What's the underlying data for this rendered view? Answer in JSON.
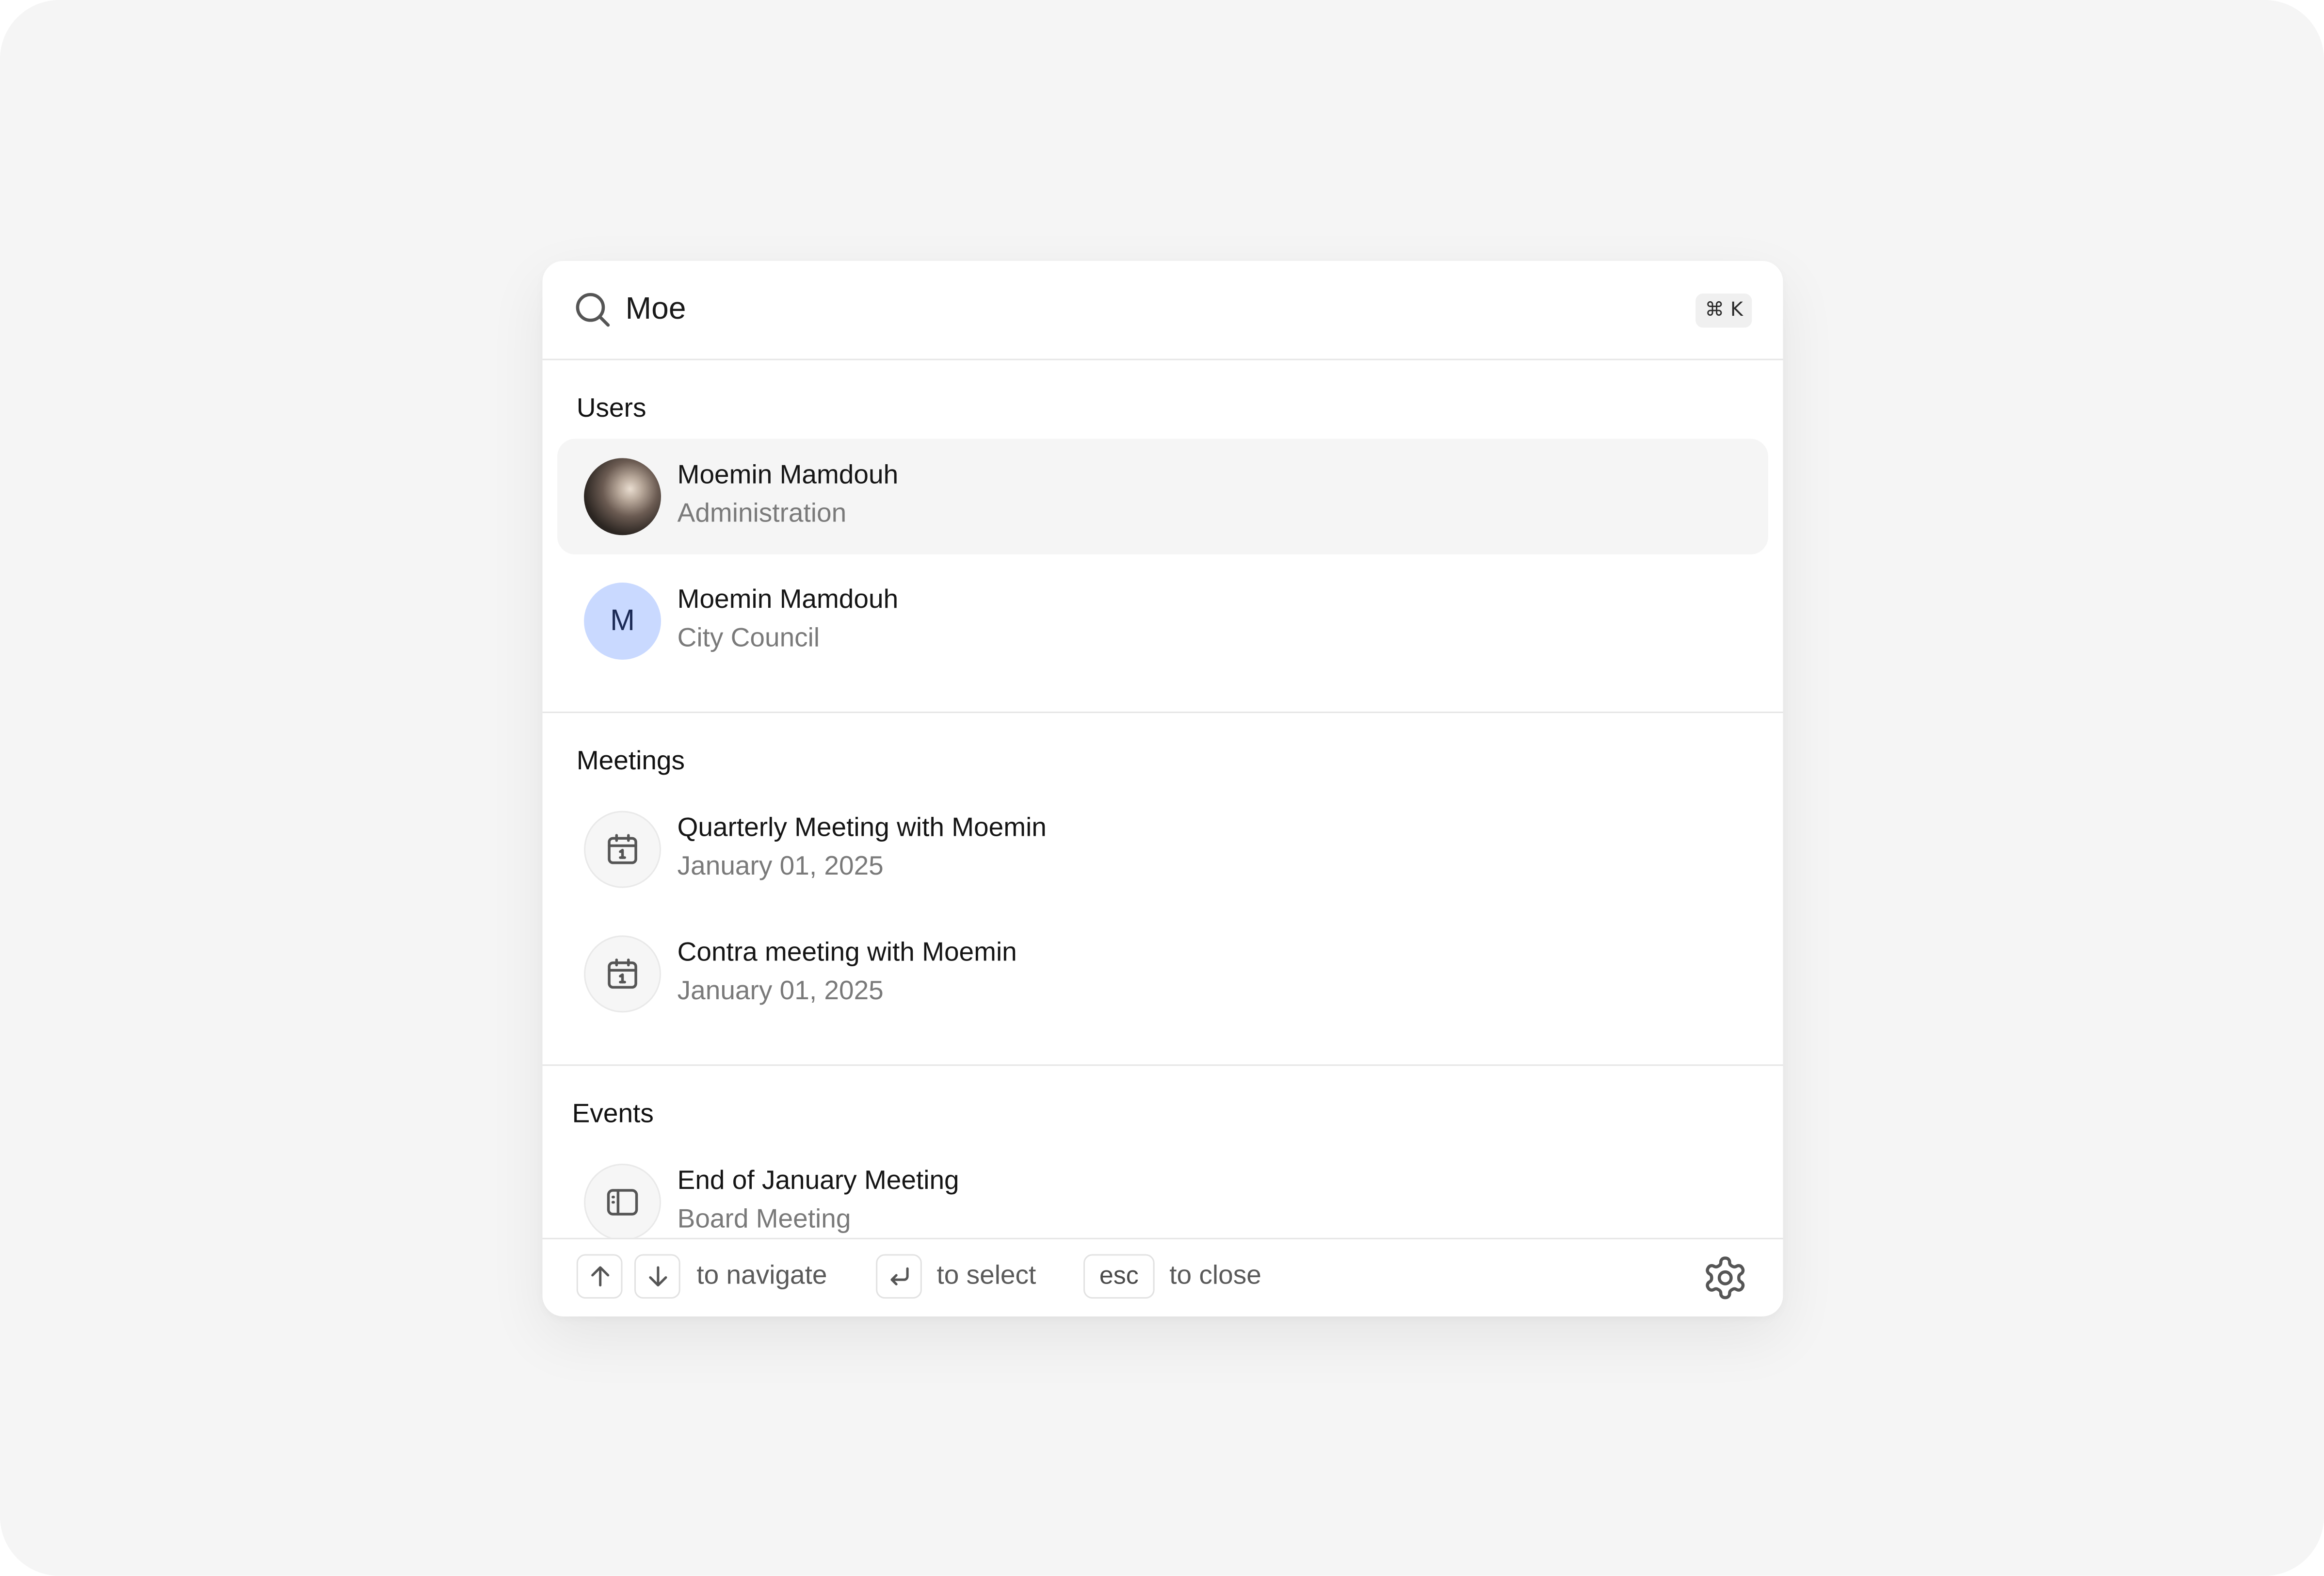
{
  "search": {
    "query": "Moe",
    "shortcut": "⌘ K"
  },
  "sections": {
    "users": {
      "title": "Users",
      "items": [
        {
          "name": "Moemin Mamdouh",
          "subtitle": "Administration",
          "avatar": "photo"
        },
        {
          "name": "Moemin Mamdouh",
          "subtitle": "City Council",
          "avatar_letter": "M"
        }
      ]
    },
    "meetings": {
      "title": "Meetings",
      "items": [
        {
          "title": "Quarterly Meeting with Moemin",
          "date": "January 01, 2025",
          "icon": "calendar-icon"
        },
        {
          "title": "Contra meeting with Moemin",
          "date": "January 01, 2025",
          "icon": "calendar-icon"
        }
      ]
    },
    "events": {
      "title": "Events",
      "items": [
        {
          "title": "End of January Meeting",
          "subtitle": "Board Meeting",
          "icon": "sidebar-panel-icon"
        }
      ]
    }
  },
  "footer": {
    "navigate_label": "to navigate",
    "select_label": "to select",
    "esc_key": "esc",
    "close_label": "to close"
  },
  "colors": {
    "background": "#f5f5f5",
    "panel": "#ffffff",
    "active_row": "#f5f5f5",
    "avatar_letter_bg": "#c9d9ff",
    "muted_text": "#7a7a7a"
  }
}
